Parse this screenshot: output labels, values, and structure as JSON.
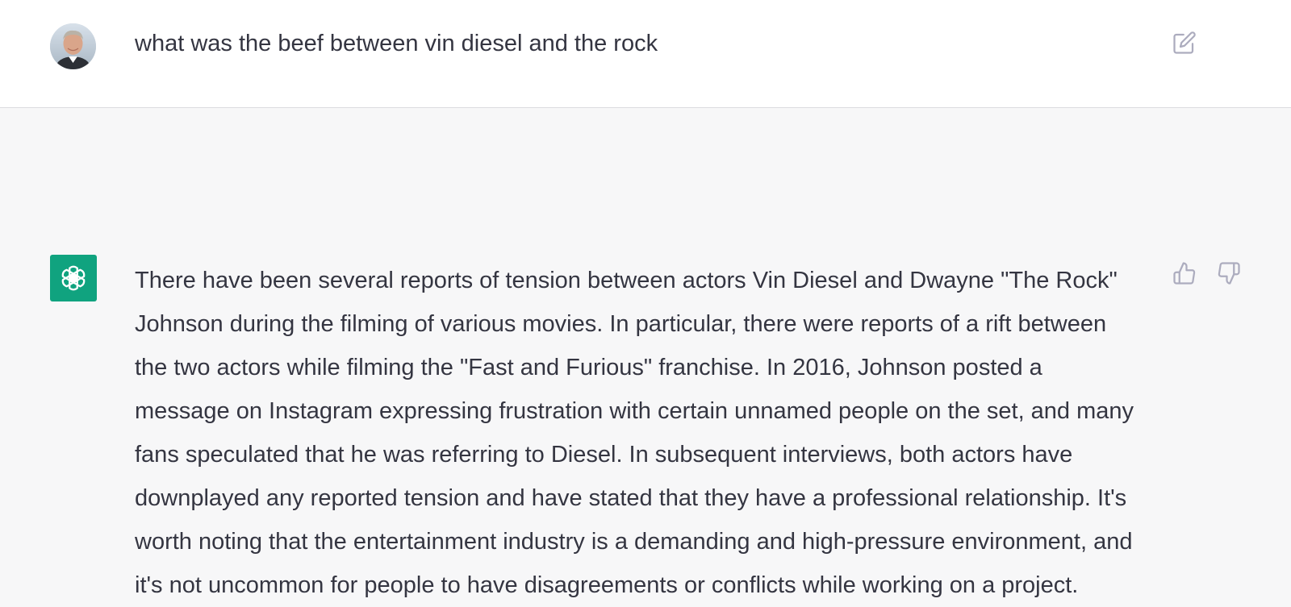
{
  "conversation": {
    "user_message": {
      "text": "what was the beef between vin diesel and the rock",
      "avatar_icon": "user-avatar-photo",
      "edit_icon": "edit-icon"
    },
    "assistant_message": {
      "text": "There have been several reports of tension between actors Vin Diesel and Dwayne \"The Rock\" Johnson during the filming of various movies. In particular, there were reports of a rift between the two actors while filming the \"Fast and Furious\" franchise. In 2016, Johnson posted a message on Instagram expressing frustration with certain unnamed people on the set, and many fans speculated that he was referring to Diesel. In subsequent interviews, both actors have downplayed any reported tension and have stated that they have a professional relationship. It's worth noting that the entertainment industry is a demanding and high-pressure environment, and it's not uncommon for people to have disagreements or conflicts while working on a project.",
      "avatar_icon": "openai-logo-icon",
      "feedback_icons": [
        "thumbs-up-icon",
        "thumbs-down-icon"
      ]
    }
  },
  "colors": {
    "user_row_bg": "#ffffff",
    "assistant_row_bg": "#f7f7f8",
    "brand_green": "#10a37f",
    "text": "#343541",
    "icon": "#acacbe"
  }
}
